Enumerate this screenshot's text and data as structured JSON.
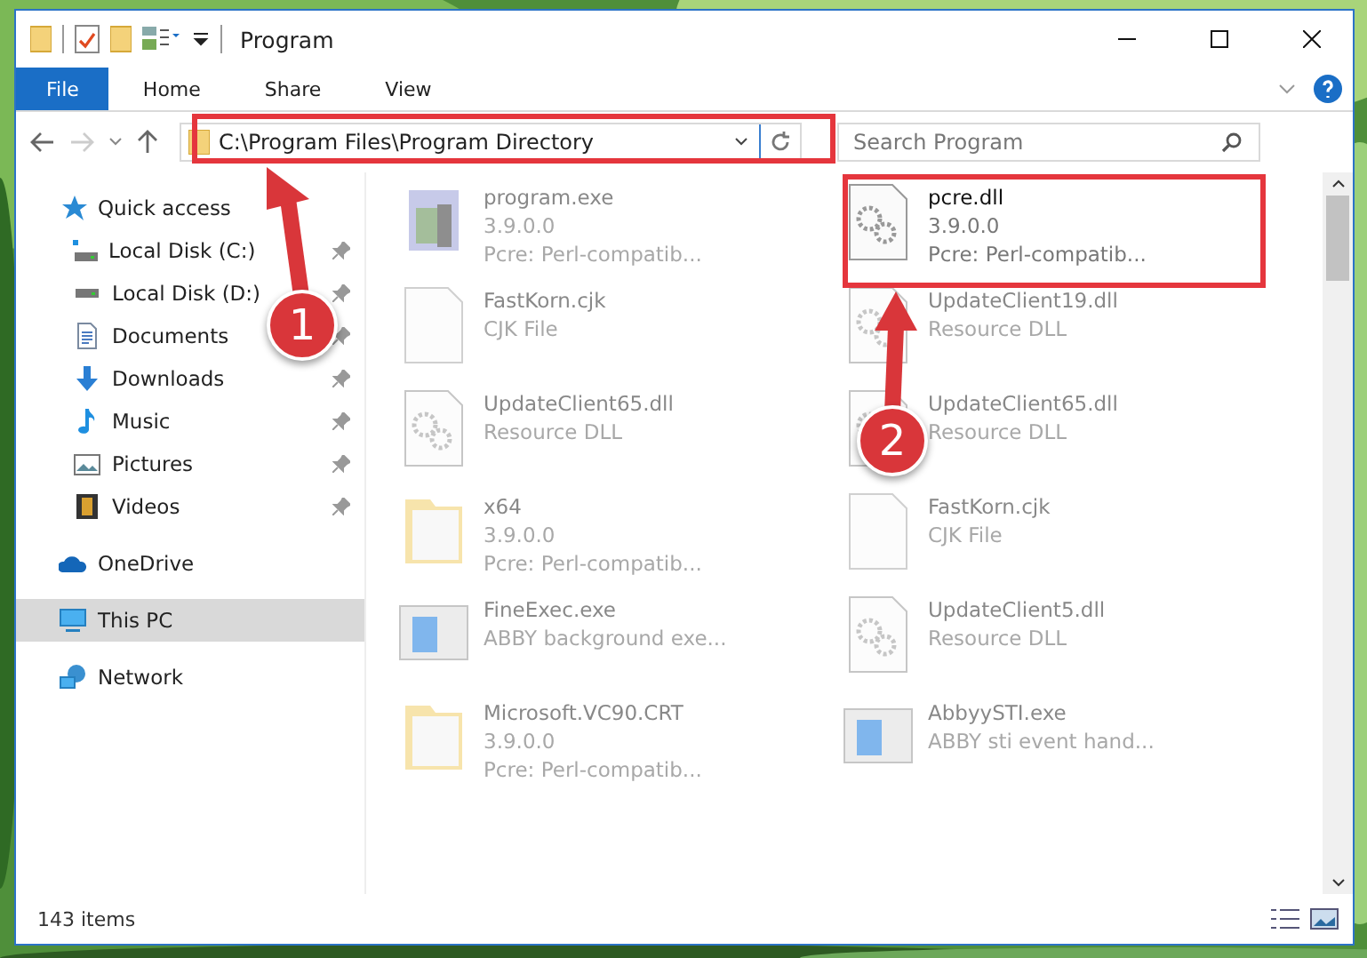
{
  "window": {
    "title": "Program"
  },
  "ribbon_tabs": [
    {
      "label": "File",
      "selected": true
    },
    {
      "label": "Home",
      "selected": false
    },
    {
      "label": "Share",
      "selected": false
    },
    {
      "label": "View",
      "selected": false
    }
  ],
  "address": {
    "path": "C:\\Program Files\\Program Directory"
  },
  "search": {
    "placeholder": "Search Program"
  },
  "sidebar": {
    "items": [
      {
        "label": "Quick access",
        "selected": false,
        "children": [
          {
            "label": "Local Disk (C:)",
            "selected": false
          },
          {
            "label": "Local Disk (D:)",
            "selected": false
          },
          {
            "label": "Documents",
            "selected": false
          },
          {
            "label": "Downloads",
            "selected": false
          },
          {
            "label": "Music",
            "selected": false
          },
          {
            "label": "Pictures",
            "selected": false
          },
          {
            "label": "Videos",
            "selected": false
          }
        ]
      },
      {
        "label": "OneDrive",
        "selected": false
      },
      {
        "label": "This PC",
        "selected": true
      },
      {
        "label": "Network",
        "selected": false
      }
    ]
  },
  "files": [
    {
      "kind": "exe",
      "name": "program.exe",
      "lines": [
        "3.9.0.0",
        "Pcre: Perl-compatib..."
      ],
      "blurred": true
    },
    {
      "kind": "dll",
      "name": "pcre.dll",
      "lines": [
        "3.9.0.0",
        "Pcre: Perl-compatib..."
      ],
      "blurred": false
    },
    {
      "kind": "blank",
      "name": "FastKorn.cjk",
      "lines": [
        "CJK File"
      ],
      "blurred": true
    },
    {
      "kind": "dll",
      "name": "UpdateClient19.dll",
      "lines": [
        "Resource DLL"
      ],
      "blurred": true
    },
    {
      "kind": "dll",
      "name": "UpdateClient65.dll",
      "lines": [
        "Resource DLL"
      ],
      "blurred": true
    },
    {
      "kind": "dll",
      "name": "UpdateClient65.dll",
      "lines": [
        "Resource DLL"
      ],
      "blurred": true
    },
    {
      "kind": "folder",
      "name": "x64",
      "lines": [
        "3.9.0.0",
        "Pcre: Perl-compatib..."
      ],
      "blurred": true
    },
    {
      "kind": "blank",
      "name": "FastKorn.cjk",
      "lines": [
        "CJK File"
      ],
      "blurred": true
    },
    {
      "kind": "app",
      "name": "FineExec.exe",
      "lines": [
        "ABBY background exe..."
      ],
      "blurred": true
    },
    {
      "kind": "dll",
      "name": "UpdateClient5.dll",
      "lines": [
        "Resource DLL"
      ],
      "blurred": true
    },
    {
      "kind": "folder",
      "name": "Microsoft.VC90.CRT",
      "lines": [
        "3.9.0.0",
        "Pcre: Perl-compatib..."
      ],
      "blurred": true
    },
    {
      "kind": "app",
      "name": "AbbyySTI.exe",
      "lines": [
        "ABBY sti event hand..."
      ],
      "blurred": true
    }
  ],
  "status_bar": {
    "count": "143 items"
  },
  "callouts": [
    {
      "number": "1"
    },
    {
      "number": "2"
    }
  ]
}
